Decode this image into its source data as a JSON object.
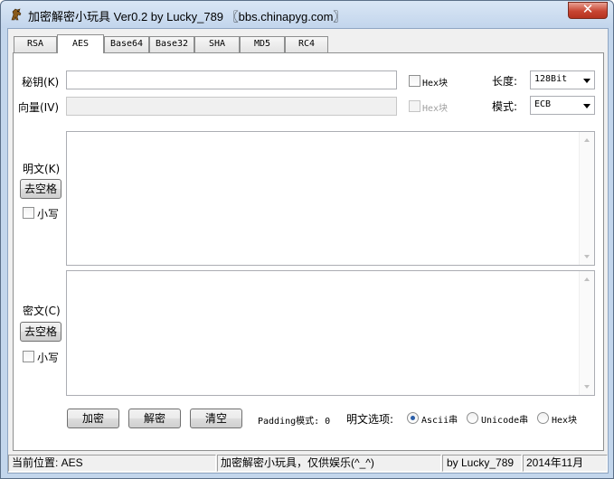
{
  "window": {
    "title": "加密解密小玩具 Ver0.2 by Lucky_789 〖bbs.chinapyg.com〗",
    "close_glyph": "✕"
  },
  "tabs": [
    {
      "label": "RSA",
      "active": false
    },
    {
      "label": "AES",
      "active": true
    },
    {
      "label": "Base64",
      "active": false
    },
    {
      "label": "Base32",
      "active": false
    },
    {
      "label": "SHA",
      "active": false
    },
    {
      "label": "MD5",
      "active": false
    },
    {
      "label": "RC4",
      "active": false
    }
  ],
  "key_row": {
    "label": "秘钥(K)",
    "value": "",
    "hex_label": "Hex块",
    "hex_checked": false,
    "length_label": "长度:",
    "length_value": "128Bit"
  },
  "iv_row": {
    "label": "向量(IV)",
    "value": "",
    "hex_label": "Hex块",
    "hex_checked": false,
    "mode_label": "模式:",
    "mode_value": "ECB"
  },
  "plaintext": {
    "label": "明文(K)",
    "trim_button": "去空格",
    "lower_label": "小写",
    "lower_checked": false,
    "value": ""
  },
  "ciphertext": {
    "label": "密文(C)",
    "trim_button": "去空格",
    "lower_label": "小写",
    "lower_checked": false,
    "value": ""
  },
  "actions": {
    "encrypt": "加密",
    "decrypt": "解密",
    "clear": "清空"
  },
  "padding": {
    "label": "Padding模式: 0"
  },
  "plaintext_options": {
    "label": "明文选项:",
    "options": [
      "Ascii串",
      "Unicode串",
      "Hex块"
    ],
    "selected": "Ascii串"
  },
  "statusbar": {
    "location": "当前位置: AES",
    "message": "加密解密小玩具，仅供娱乐(^_^)",
    "author": "by Lucky_789",
    "date": "2014年11月"
  }
}
